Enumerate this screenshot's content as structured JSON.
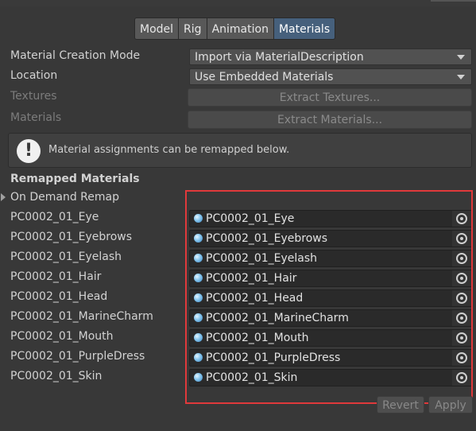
{
  "tabs": [
    {
      "label": "Model",
      "active": false
    },
    {
      "label": "Rig",
      "active": false
    },
    {
      "label": "Animation",
      "active": false
    },
    {
      "label": "Materials",
      "active": true
    }
  ],
  "settings": {
    "creation_mode_label": "Material Creation Mode",
    "creation_mode_value": "Import via MaterialDescription",
    "location_label": "Location",
    "location_value": "Use Embedded Materials",
    "textures_label": "Textures",
    "extract_textures_label": "Extract Textures...",
    "materials_label": "Materials",
    "extract_materials_label": "Extract Materials..."
  },
  "help": {
    "icon": "!",
    "text": "Material assignments can be remapped below."
  },
  "remapped": {
    "title": "Remapped Materials",
    "foldout_label": "On Demand Remap",
    "items": [
      {
        "name": "PC0002_01_Eye",
        "value": "PC0002_01_Eye"
      },
      {
        "name": "PC0002_01_Eyebrows",
        "value": "PC0002_01_Eyebrows"
      },
      {
        "name": "PC0002_01_Eyelash",
        "value": "PC0002_01_Eyelash"
      },
      {
        "name": "PC0002_01_Hair",
        "value": "PC0002_01_Hair"
      },
      {
        "name": "PC0002_01_Head",
        "value": "PC0002_01_Head"
      },
      {
        "name": "PC0002_01_MarineCharm",
        "value": "PC0002_01_MarineCharm"
      },
      {
        "name": "PC0002_01_Mouth",
        "value": "PC0002_01_Mouth"
      },
      {
        "name": "PC0002_01_PurpleDress",
        "value": "PC0002_01_PurpleDress"
      },
      {
        "name": "PC0002_01_Skin",
        "value": "PC0002_01_Skin"
      }
    ]
  },
  "footer": {
    "revert_label": "Revert",
    "apply_label": "Apply"
  },
  "colors": {
    "background": "#383838",
    "active_tab": "#46607c",
    "highlight_border": "#e0393b",
    "material_icon": "#8ccaf0"
  }
}
